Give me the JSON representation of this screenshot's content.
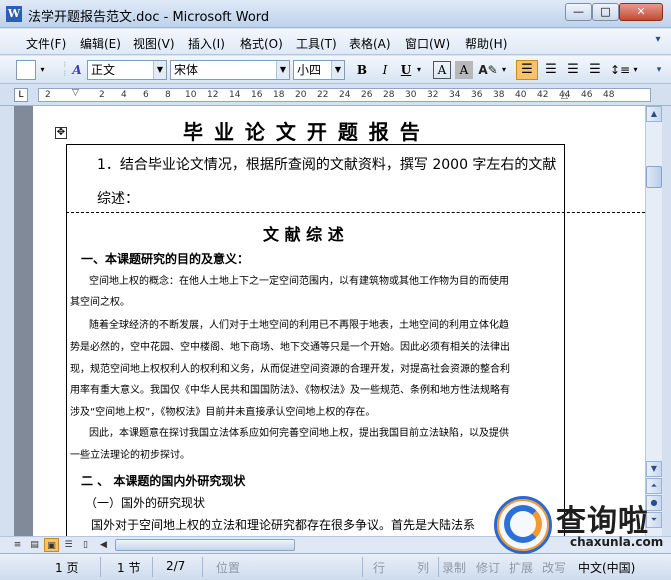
{
  "window": {
    "title": "法学开题报告范文.doc - Microsoft Word",
    "app_icon": "W",
    "min": "—",
    "max": "□",
    "close": "✕"
  },
  "menu": [
    "文件(F)",
    "编辑(E)",
    "视图(V)",
    "插入(I)",
    "格式(O)",
    "工具(T)",
    "表格(A)",
    "窗口(W)",
    "帮助(H)"
  ],
  "menu_end": "▾",
  "toolbar": {
    "style": "正文",
    "style_icon": "A",
    "font": "宋体",
    "size": "小四",
    "bold": "B",
    "italic": "I",
    "underline": "U",
    "char_border": "A",
    "char_shading": "A"
  },
  "ruler": {
    "corner": "L",
    "ticks": [
      "2",
      "2",
      "4",
      "6",
      "8",
      "10",
      "12",
      "14",
      "16",
      "18",
      "20",
      "22",
      "24",
      "26",
      "28",
      "30",
      "32",
      "34",
      "36",
      "38",
      "40",
      "42",
      "44",
      "46",
      "48"
    ]
  },
  "document": {
    "heading": "毕 业 论 文 开 题 报 告",
    "instruction": "1．结合毕业论文情况，根据所查阅的文献资料，撰写 2000 字左右的文献",
    "review_label": "综述：",
    "section_title": "文  献  综  述",
    "h1": "一、本课题研究的目的及意义：",
    "p1a": "空间地上权的概念：在他人土地上下之一定空间范围内，以有建筑物或其他工作物为目的而使用",
    "p1b": "其空间之权。",
    "p2a": "随着全球经济的不断发展，人们对于土地空间的利用已不再限于地表，土地空间的利用立体化趋",
    "p2b": "势是必然的，空中花园、空中楼阁、地下商场、地下交通等只是一个开始。因此必须有相关的法律出",
    "p2c": "现，规范空间地上权权利人的权利和义务，从而促进空间资源的合理开发，对提高社会资源的整合利",
    "p2d": "用率有重大意义。我国仅《中华人民共和国国防法》、《物权法》及一些规范、条例和地方性法规略有",
    "p2e": "涉及“空间地上权”，《物权法》目前并未直接承认空间地上权的存在。",
    "p3a": "因此，本课题意在探讨我国立法体系应如何完善空间地上权，提出我国目前立法缺陷，以及提供",
    "p3b": "一些立法理论的初步探讨。",
    "h2": "二 、  本课题的国内外研究现状",
    "h3": "（一）国外的研究现状",
    "p4": "国外对于空间地上权的立法和理论研究都存在很多争议。首先是大陆法系"
  },
  "status": {
    "page": "1 页",
    "section": "1 节",
    "pages": "2/7",
    "position": "位置",
    "line": "行",
    "col": "列",
    "rec": "录制",
    "trk": "修订",
    "ext": "扩展",
    "ovr": "改写",
    "lang": "中文(中国)"
  },
  "watermark": {
    "brand": "查询啦",
    "domain": "chaxunla.com"
  },
  "colors": {
    "accent": "#2a68d1",
    "orange": "#f29a2e"
  }
}
